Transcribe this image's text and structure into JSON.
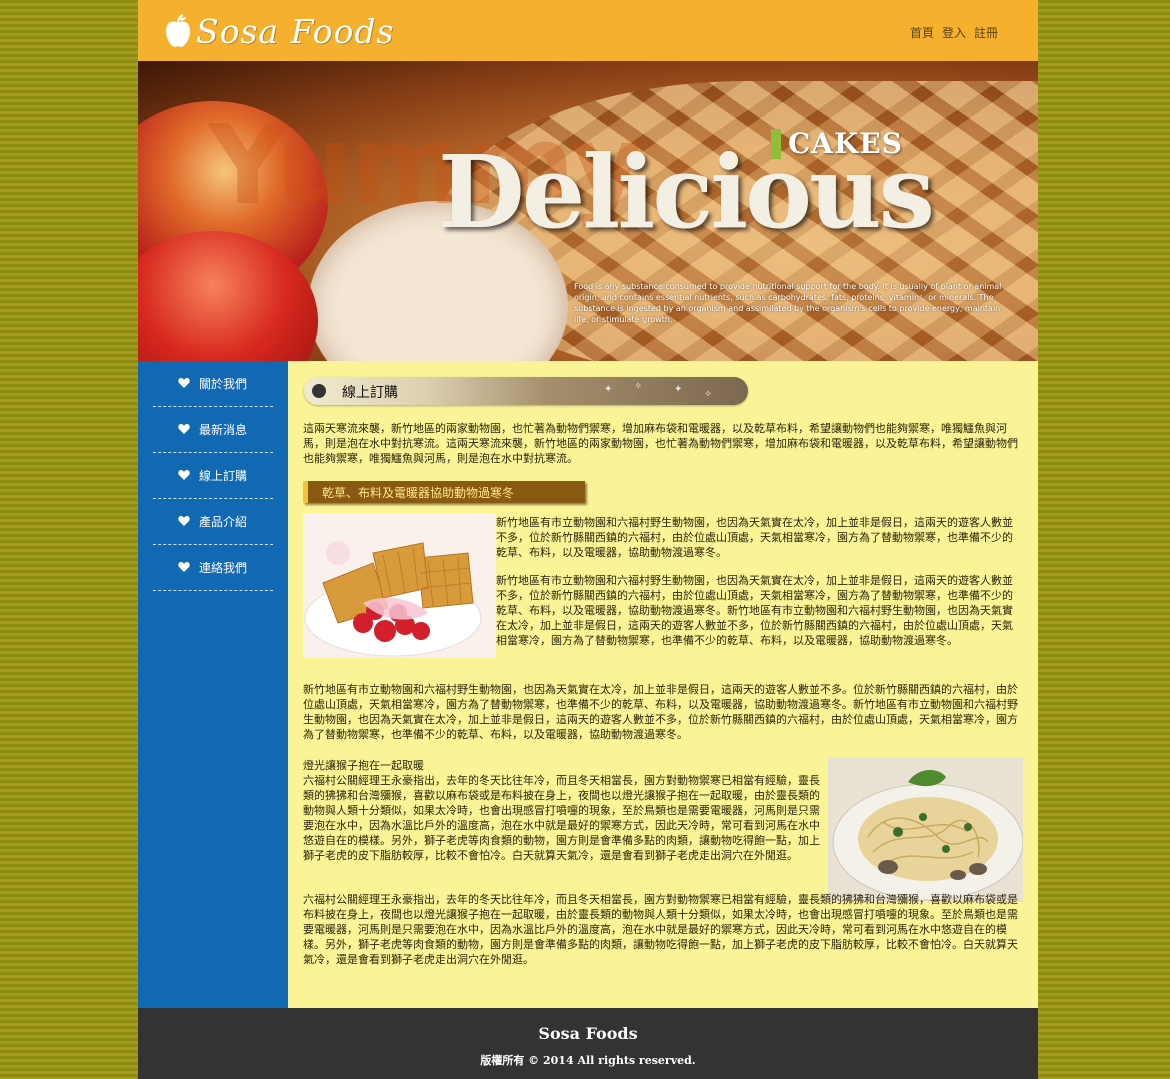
{
  "brand": {
    "name": "Sosa Foods"
  },
  "topnav": [
    {
      "label": "首頁"
    },
    {
      "label": "登入"
    },
    {
      "label": "註冊"
    }
  ],
  "banner": {
    "big_word": "Delicious",
    "watermark": "Yummy",
    "badge": "CAKES",
    "tagline": "Food is any substance consumed to provide nutritional support for the body. It is usually of plant or animal origin, and contains essential nutrients, such as carbohydrates, fats, proteins, vitamins, or minerals. The substance is ingested by an organism and assimilated by the organism's cells to provide energy, maintain life, or stimulate growth."
  },
  "sidebar": {
    "items": [
      {
        "label": "關於我們"
      },
      {
        "label": "最新消息"
      },
      {
        "label": "線上訂購"
      },
      {
        "label": "產品介紹"
      },
      {
        "label": "連絡我們"
      }
    ]
  },
  "main": {
    "section_title": "線上訂購",
    "intro": "這兩天寒流來襲，新竹地區的兩家動物園，也忙著為動物們禦寒，增加麻布袋和電暖器，以及乾草布料，希望讓動物們也能夠禦寒，唯獨鱷魚與河馬，則是泡在水中對抗寒流。這兩天寒流來襲，新竹地區的兩家動物園，也忙著為動物們禦寒，增加麻布袋和電暖器，以及乾草布料，希望讓動物們也能夠禦寒，唯獨鱷魚與河馬，則是泡在水中對抗寒流。",
    "subheading": "乾草、布料及電暖器協助動物過寒冬",
    "para2": "新竹地區有市立動物園和六福村野生動物園，也因為天氣實在太冷，加上並非是假日，這兩天的遊客人數並不多，位於新竹縣關西鎮的六福村，由於位處山頂處，天氣相當寒冷，園方為了替動物禦寒，也準備不少的乾草、布料，以及電暖器，協助動物渡過寒冬。",
    "para3": "新竹地區有市立動物園和六福村野生動物園，也因為天氣實在太冷，加上並非是假日，這兩天的遊客人數並不多，位於新竹縣關西鎮的六福村，由於位處山頂處，天氣相當寒冷，園方為了替動物禦寒，也準備不少的乾草、布料，以及電暖器，協助動物渡過寒冬。新竹地區有市立動物園和六福村野生動物園，也因為天氣實在太冷，加上並非是假日，這兩天的遊客人數並不多，位於新竹縣關西鎮的六福村，由於位處山頂處，天氣相當寒冷，園方為了替動物禦寒，也準備不少的乾草、布料，以及電暖器，協助動物渡過寒冬。",
    "para4": "新竹地區有市立動物園和六福村野生動物園，也因為天氣實在太冷，加上並非是假日，這兩天的遊客人數並不多。位於新竹縣關西鎮的六福村，由於位處山頂處，天氣相當寒冷，園方為了替動物禦寒，也準備不少的乾草、布料，以及電暖器，協助動物渡過寒冬。新竹地區有市立動物園和六福村野生動物園，也因為天氣實在太冷，加上並非是假日，這兩天的遊客人數並不多，位於新竹縣關西鎮的六福村，由於位處山頂處，天氣相當寒冷，園方為了替動物禦寒，也準備不少的乾草、布料，以及電暖器，協助動物渡過寒冬。",
    "para5_title": "燈光讓猴子抱在一起取暖",
    "para5": "六福村公關經理王永豪指出，去年的冬天比往年冷，而且冬天相當長，園方對動物禦寒已相當有經驗，靈長類的狒狒和台灣獼猴，喜歡以麻布袋或是布料披在身上，夜間也以燈光讓猴子抱在一起取暖，由於靈長類的動物與人類十分類似，如果太冷時，也會出現感冒打噴嚏的現象，至於鳥類也是需要電暖器，河馬則是只需要泡在水中，因為水溫比戶外的溫度高，泡在水中就是最好的禦寒方式，因此天冷時，常可看到河馬在水中悠遊自在的模樣。另外，獅子老虎等肉食類的動物，園方則是會準備多點的肉類，讓動物吃得飽一點，加上獅子老虎的皮下脂肪較厚，比較不會怕冷。白天就算天氣冷，還是會看到獅子老虎走出洞穴在外閒逛。",
    "para6": "六福村公關經理王永豪指出，去年的冬天比往年冷，而且冬天相當長，園方對動物禦寒已相當有經驗，靈長類的狒狒和台灣獼猴，喜歡以麻布袋或是布料披在身上，夜間也以燈光讓猴子抱在一起取暖，由於靈長類的動物與人類十分類似，如果太冷時，也會出現感冒打噴嚏的現象。至於鳥類也是需要電暖器，河馬則是只需要泡在水中，因為水溫比戶外的溫度高，泡在水中就是最好的禦寒方式，因此天冷時，常可看到河馬在水中悠遊自在的模樣。另外，獅子老虎等肉食類的動物，園方則是會準備多點的肉類，讓動物吃得飽一點，加上獅子老虎的皮下脂肪較厚，比較不會怕冷。白天就算天氣冷，還是會看到獅子老虎走出洞穴在外閒逛。"
  },
  "footer": {
    "name": "Sosa Foods",
    "copyright": "版權所有 © 2014 All rights reserved."
  },
  "colors": {
    "header": "#f5b02e",
    "sidebar": "#1168b3",
    "content_bg": "#faf497",
    "footer": "#333333",
    "page_bg": "#8f8a12",
    "subhead": "#8b5a12"
  }
}
